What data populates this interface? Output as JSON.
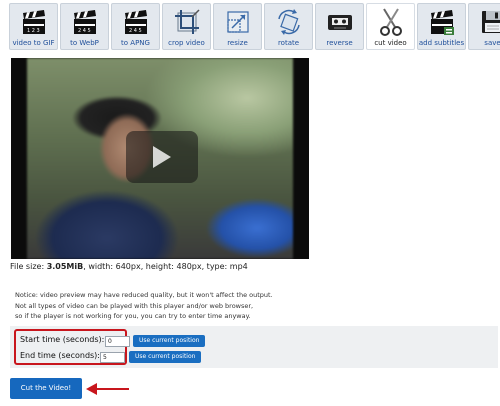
{
  "toolbar": {
    "tools": [
      {
        "label": "video to GIF",
        "icon": "clapperboard-icon"
      },
      {
        "label": "to WebP",
        "icon": "clapperboard-icon"
      },
      {
        "label": "to APNG",
        "icon": "clapperboard-icon"
      },
      {
        "label": "crop video",
        "icon": "crop-icon"
      },
      {
        "label": "resize",
        "icon": "resize-icon"
      },
      {
        "label": "rotate",
        "icon": "rotate-icon"
      },
      {
        "label": "reverse",
        "icon": "cassette-icon"
      },
      {
        "label": "cut video",
        "icon": "scissors-icon",
        "active": true
      },
      {
        "label": "add subtitles",
        "icon": "clapperboard-subtitles-icon"
      },
      {
        "label": "save",
        "icon": "floppy-disk-icon"
      }
    ]
  },
  "file_info": {
    "prefix": "File size: ",
    "size": "3.05MiB",
    "details": ", width: 640px, height: 480px, type: mp4"
  },
  "notice": {
    "line1": "Notice: video preview may have reduced quality, but it won't affect the output.",
    "line2": "Not all types of video can be played with this player and/or web browser,",
    "line3": "so if the player is not working for you, you can try to enter time anyway."
  },
  "cut_form": {
    "start_label": "Start time (seconds):",
    "start_value": "0",
    "end_label": "End time (seconds):",
    "end_value": "5",
    "use_position_label": "Use current position",
    "submit_label": "Cut the Video!"
  },
  "colors": {
    "accent_blue": "#1668be",
    "highlight_red": "#c8161d"
  }
}
